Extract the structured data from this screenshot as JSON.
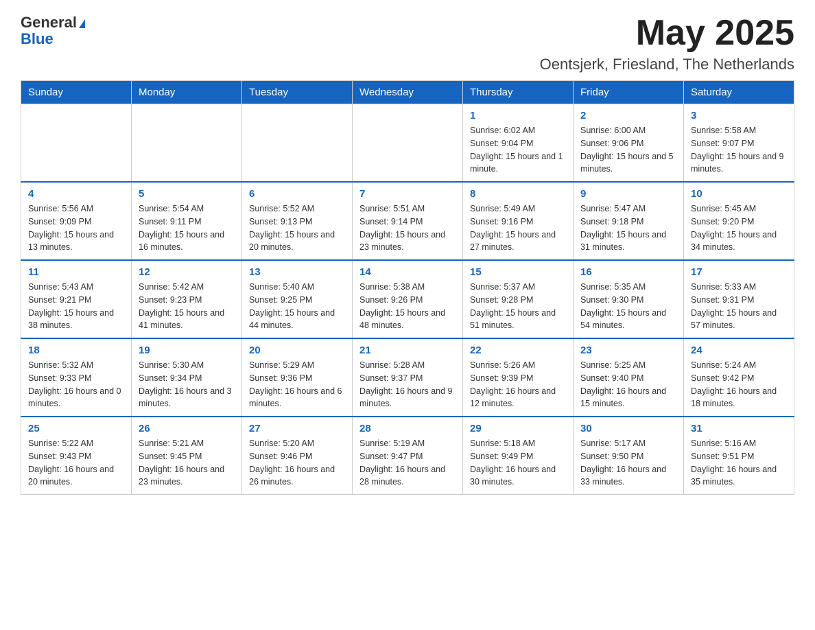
{
  "header": {
    "logo_general": "General",
    "logo_blue": "Blue",
    "month_title": "May 2025",
    "location": "Oentsjerk, Friesland, The Netherlands"
  },
  "weekdays": [
    "Sunday",
    "Monday",
    "Tuesday",
    "Wednesday",
    "Thursday",
    "Friday",
    "Saturday"
  ],
  "weeks": [
    [
      {
        "day": "",
        "info": ""
      },
      {
        "day": "",
        "info": ""
      },
      {
        "day": "",
        "info": ""
      },
      {
        "day": "",
        "info": ""
      },
      {
        "day": "1",
        "info": "Sunrise: 6:02 AM\nSunset: 9:04 PM\nDaylight: 15 hours and 1 minute."
      },
      {
        "day": "2",
        "info": "Sunrise: 6:00 AM\nSunset: 9:06 PM\nDaylight: 15 hours and 5 minutes."
      },
      {
        "day": "3",
        "info": "Sunrise: 5:58 AM\nSunset: 9:07 PM\nDaylight: 15 hours and 9 minutes."
      }
    ],
    [
      {
        "day": "4",
        "info": "Sunrise: 5:56 AM\nSunset: 9:09 PM\nDaylight: 15 hours and 13 minutes."
      },
      {
        "day": "5",
        "info": "Sunrise: 5:54 AM\nSunset: 9:11 PM\nDaylight: 15 hours and 16 minutes."
      },
      {
        "day": "6",
        "info": "Sunrise: 5:52 AM\nSunset: 9:13 PM\nDaylight: 15 hours and 20 minutes."
      },
      {
        "day": "7",
        "info": "Sunrise: 5:51 AM\nSunset: 9:14 PM\nDaylight: 15 hours and 23 minutes."
      },
      {
        "day": "8",
        "info": "Sunrise: 5:49 AM\nSunset: 9:16 PM\nDaylight: 15 hours and 27 minutes."
      },
      {
        "day": "9",
        "info": "Sunrise: 5:47 AM\nSunset: 9:18 PM\nDaylight: 15 hours and 31 minutes."
      },
      {
        "day": "10",
        "info": "Sunrise: 5:45 AM\nSunset: 9:20 PM\nDaylight: 15 hours and 34 minutes."
      }
    ],
    [
      {
        "day": "11",
        "info": "Sunrise: 5:43 AM\nSunset: 9:21 PM\nDaylight: 15 hours and 38 minutes."
      },
      {
        "day": "12",
        "info": "Sunrise: 5:42 AM\nSunset: 9:23 PM\nDaylight: 15 hours and 41 minutes."
      },
      {
        "day": "13",
        "info": "Sunrise: 5:40 AM\nSunset: 9:25 PM\nDaylight: 15 hours and 44 minutes."
      },
      {
        "day": "14",
        "info": "Sunrise: 5:38 AM\nSunset: 9:26 PM\nDaylight: 15 hours and 48 minutes."
      },
      {
        "day": "15",
        "info": "Sunrise: 5:37 AM\nSunset: 9:28 PM\nDaylight: 15 hours and 51 minutes."
      },
      {
        "day": "16",
        "info": "Sunrise: 5:35 AM\nSunset: 9:30 PM\nDaylight: 15 hours and 54 minutes."
      },
      {
        "day": "17",
        "info": "Sunrise: 5:33 AM\nSunset: 9:31 PM\nDaylight: 15 hours and 57 minutes."
      }
    ],
    [
      {
        "day": "18",
        "info": "Sunrise: 5:32 AM\nSunset: 9:33 PM\nDaylight: 16 hours and 0 minutes."
      },
      {
        "day": "19",
        "info": "Sunrise: 5:30 AM\nSunset: 9:34 PM\nDaylight: 16 hours and 3 minutes."
      },
      {
        "day": "20",
        "info": "Sunrise: 5:29 AM\nSunset: 9:36 PM\nDaylight: 16 hours and 6 minutes."
      },
      {
        "day": "21",
        "info": "Sunrise: 5:28 AM\nSunset: 9:37 PM\nDaylight: 16 hours and 9 minutes."
      },
      {
        "day": "22",
        "info": "Sunrise: 5:26 AM\nSunset: 9:39 PM\nDaylight: 16 hours and 12 minutes."
      },
      {
        "day": "23",
        "info": "Sunrise: 5:25 AM\nSunset: 9:40 PM\nDaylight: 16 hours and 15 minutes."
      },
      {
        "day": "24",
        "info": "Sunrise: 5:24 AM\nSunset: 9:42 PM\nDaylight: 16 hours and 18 minutes."
      }
    ],
    [
      {
        "day": "25",
        "info": "Sunrise: 5:22 AM\nSunset: 9:43 PM\nDaylight: 16 hours and 20 minutes."
      },
      {
        "day": "26",
        "info": "Sunrise: 5:21 AM\nSunset: 9:45 PM\nDaylight: 16 hours and 23 minutes."
      },
      {
        "day": "27",
        "info": "Sunrise: 5:20 AM\nSunset: 9:46 PM\nDaylight: 16 hours and 26 minutes."
      },
      {
        "day": "28",
        "info": "Sunrise: 5:19 AM\nSunset: 9:47 PM\nDaylight: 16 hours and 28 minutes."
      },
      {
        "day": "29",
        "info": "Sunrise: 5:18 AM\nSunset: 9:49 PM\nDaylight: 16 hours and 30 minutes."
      },
      {
        "day": "30",
        "info": "Sunrise: 5:17 AM\nSunset: 9:50 PM\nDaylight: 16 hours and 33 minutes."
      },
      {
        "day": "31",
        "info": "Sunrise: 5:16 AM\nSunset: 9:51 PM\nDaylight: 16 hours and 35 minutes."
      }
    ]
  ]
}
